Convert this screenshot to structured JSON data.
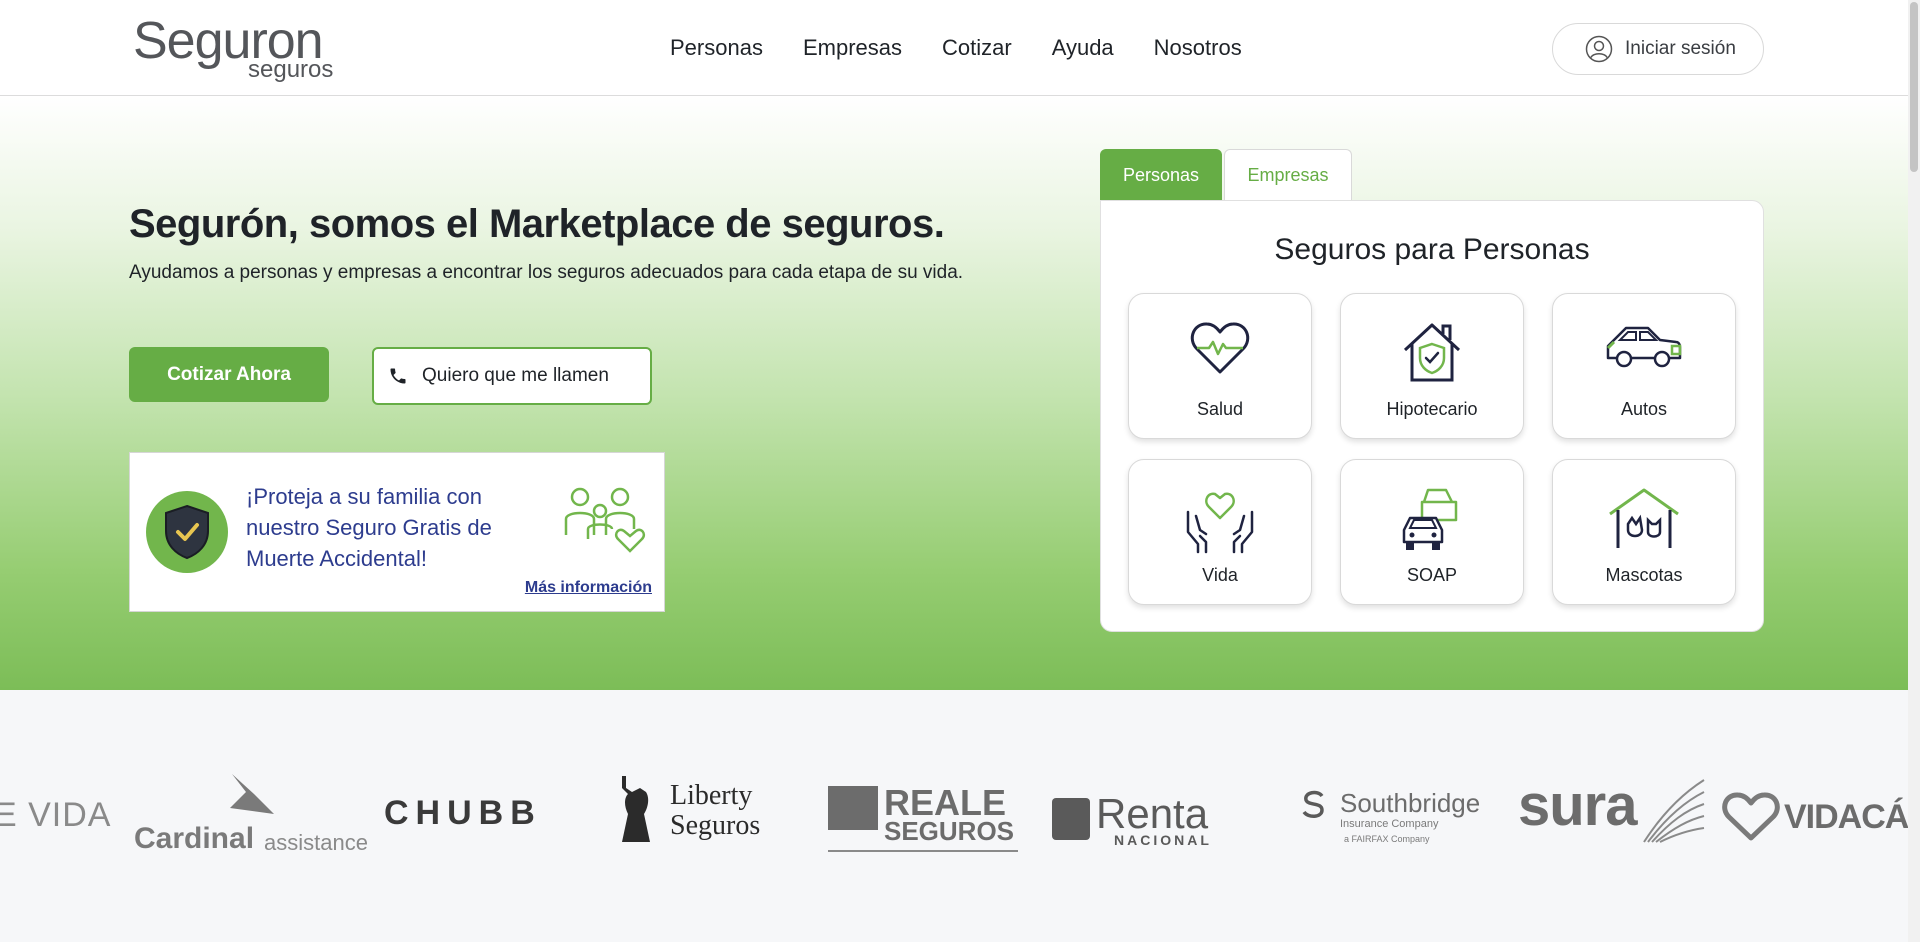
{
  "header": {
    "logo_main": "Seguron",
    "logo_sub": "seguros",
    "nav": [
      "Personas",
      "Empresas",
      "Cotizar",
      "Ayuda",
      "Nosotros"
    ],
    "login_label": "Iniciar sesión"
  },
  "hero": {
    "title": "Segurón, somos el Marketplace de seguros.",
    "subtitle": "Ayudamos a personas y empresas a encontrar los seguros adecuados para cada etapa de su vida.",
    "cta_primary": "Cotizar Ahora",
    "cta_secondary": "Quiero que me llamen",
    "promo_text": "¡Proteja a su familia con nuestro Seguro Gratis de Muerte Accidental!",
    "promo_link": "Más información"
  },
  "insurance": {
    "tabs": [
      "Personas",
      "Empresas"
    ],
    "active_tab": "Personas",
    "title": "Seguros para Personas",
    "cards": [
      "Salud",
      "Hipotecario",
      "Autos",
      "Vida",
      "SOAP",
      "Mascotas"
    ]
  },
  "partners": {
    "vida_partial": "E VIDA",
    "cardinal_main": "Cardinal",
    "cardinal_sub": "assistance",
    "chubb": "CHUBB",
    "liberty_1": "Liberty",
    "liberty_2": "Seguros",
    "reale_1": "REALE",
    "reale_2": "SEGUROS",
    "renta_1": "Renta",
    "renta_2": "NACIONAL",
    "southbridge": "Southbridge",
    "southbridge_sub": "Insurance Company",
    "southbridge_sub2": "a FAIRFAX Company",
    "sura": "sura",
    "vidacamara": "VIDACÁ"
  },
  "colors": {
    "brand_green": "#66ad45",
    "promo_blue": "#2d3c8e",
    "icon_dark": "#1f2340"
  }
}
